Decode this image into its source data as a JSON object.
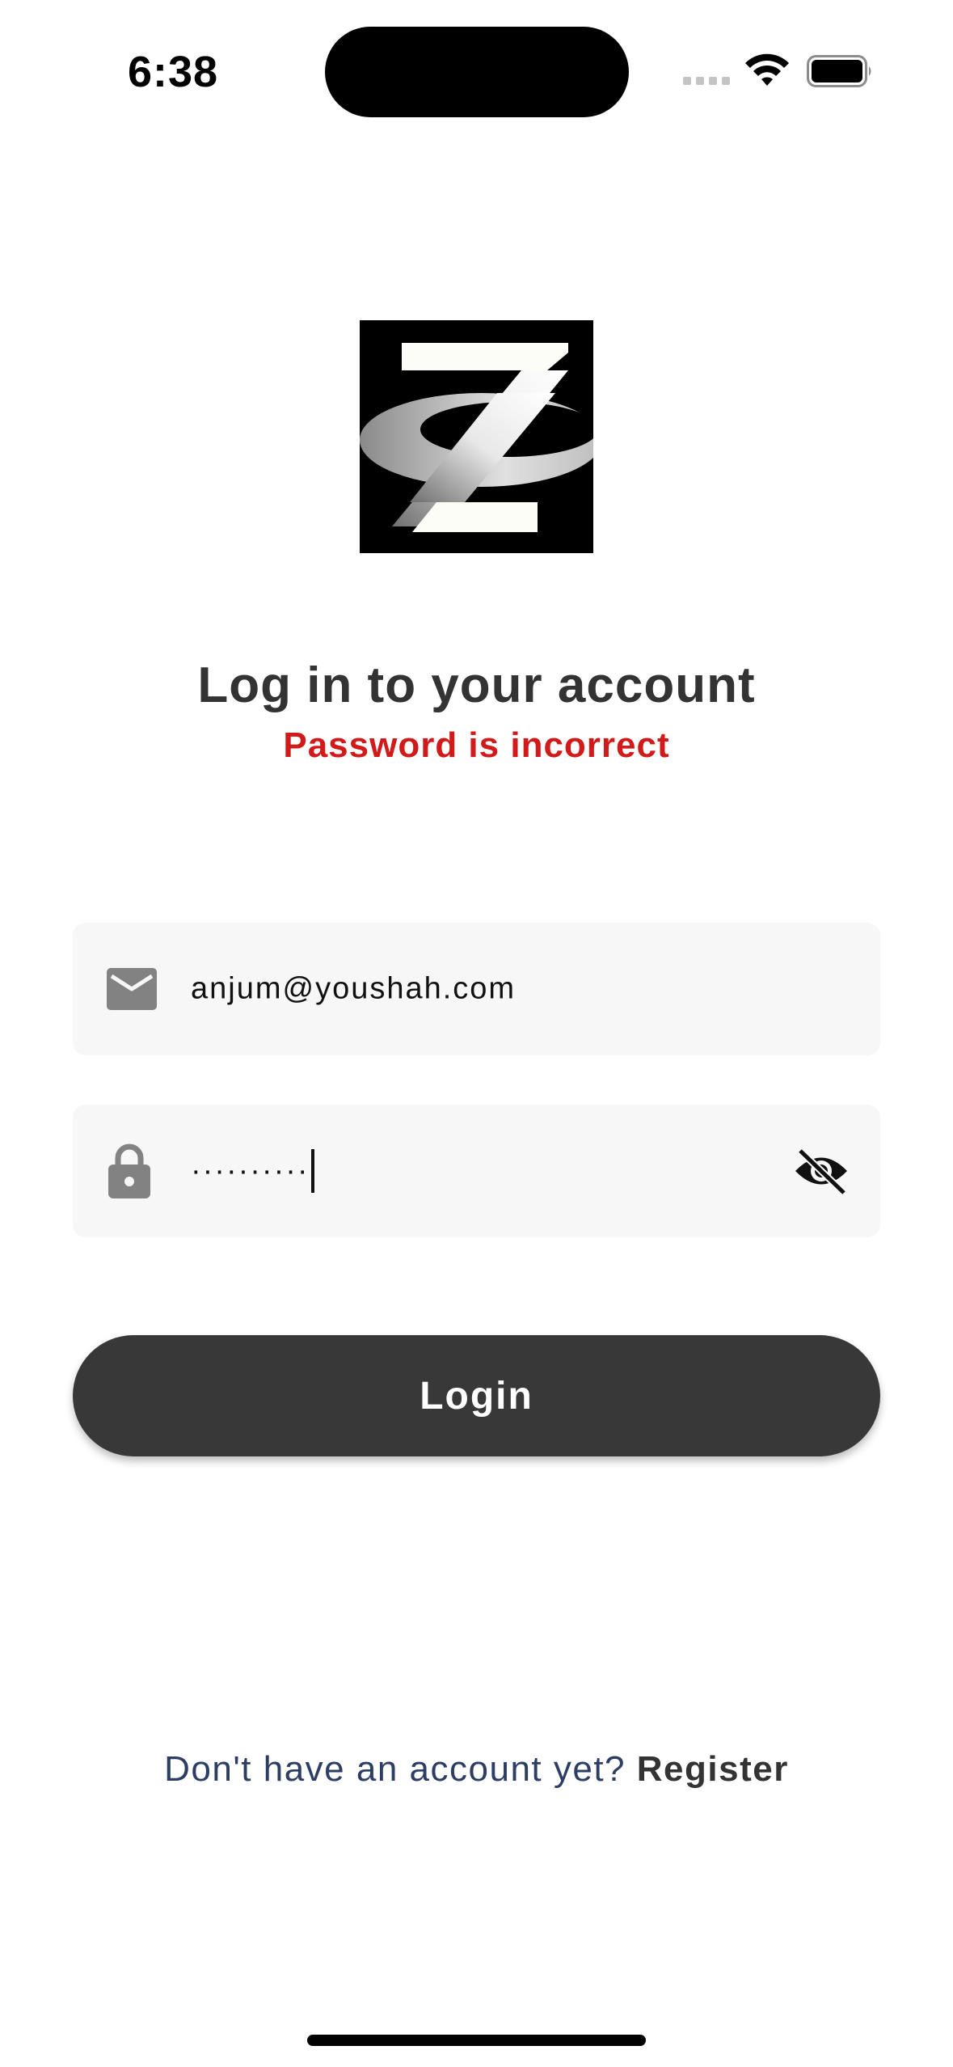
{
  "status_bar": {
    "time": "6:38"
  },
  "heading": {
    "title": "Log in to your account",
    "error": "Password is incorrect"
  },
  "form": {
    "email_value": "anjum@youshah.com",
    "password_masked": "··········"
  },
  "login_button": {
    "label": "Login"
  },
  "footer": {
    "question": "Don't have an account yet?",
    "register_link": "Register"
  },
  "colors": {
    "accent": "#383838",
    "error": "#d11a1a",
    "field_bg": "#f7f7f7"
  },
  "icons": [
    "wifi-icon",
    "battery-icon",
    "mail-icon",
    "lock-icon",
    "eye-off-icon"
  ]
}
